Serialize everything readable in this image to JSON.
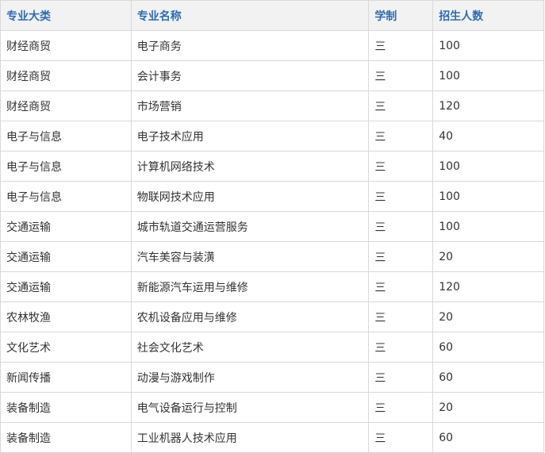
{
  "table": {
    "headers": [
      "专业大类",
      "专业名称",
      "学制",
      "招生人数"
    ],
    "rows": [
      [
        "财经商贸",
        "电子商务",
        "三",
        "100"
      ],
      [
        "财经商贸",
        "会计事务",
        "三",
        "100"
      ],
      [
        "财经商贸",
        "市场营销",
        "三",
        "120"
      ],
      [
        "电子与信息",
        "电子技术应用",
        "三",
        "40"
      ],
      [
        "电子与信息",
        "计算机网络技术",
        "三",
        "100"
      ],
      [
        "电子与信息",
        "物联网技术应用",
        "三",
        "100"
      ],
      [
        "交通运输",
        "城市轨道交通运营服务",
        "三",
        "100"
      ],
      [
        "交通运输",
        "汽车美容与装潢",
        "三",
        "20"
      ],
      [
        "交通运输",
        "新能源汽车运用与维修",
        "三",
        "120"
      ],
      [
        "农林牧渔",
        "农机设备应用与维修",
        "三",
        "20"
      ],
      [
        "文化艺术",
        "社会文化艺术",
        "三",
        "60"
      ],
      [
        "新闻传播",
        "动漫与游戏制作",
        "三",
        "60"
      ],
      [
        "装备制造",
        "电气设备运行与控制",
        "三",
        "20"
      ],
      [
        "装备制造",
        "工业机器人技术应用",
        "三",
        "60"
      ]
    ]
  },
  "colors": {
    "header_text": "#2b6cb8",
    "header_bg": "#f2f2f2",
    "border": "#d9d9d9",
    "body_text": "#333333"
  }
}
